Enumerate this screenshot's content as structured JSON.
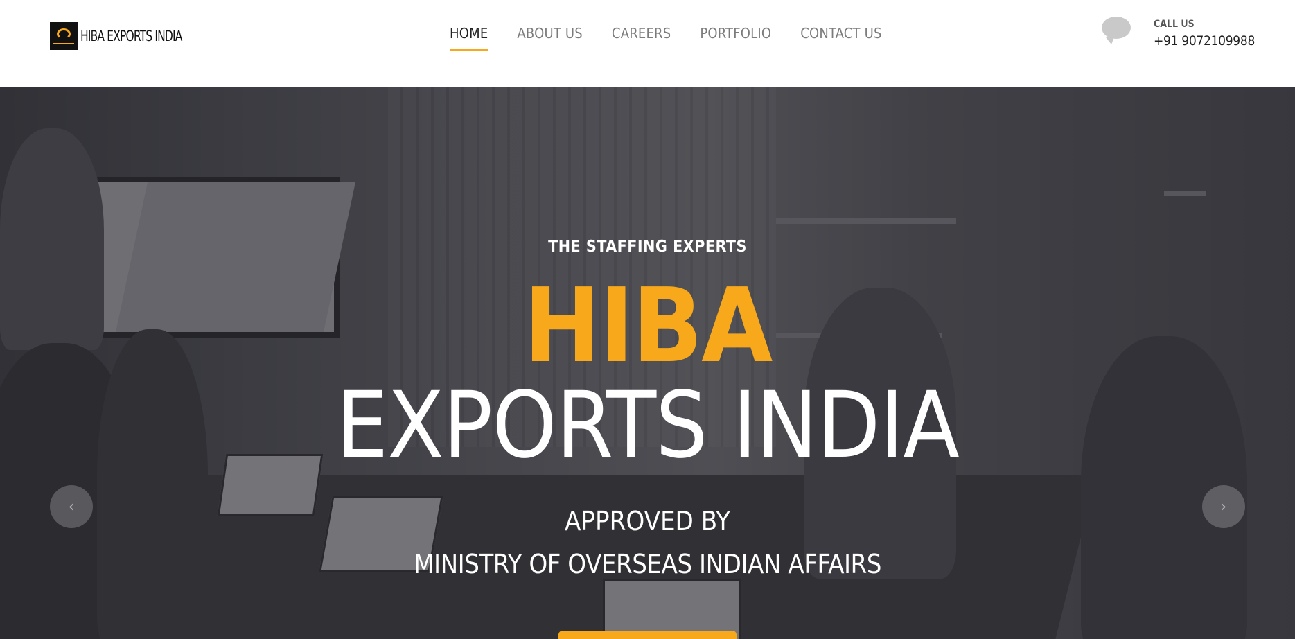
{
  "header": {
    "logo_text": "HIBA EXPORTS INDIA",
    "nav": [
      {
        "label": "HOME",
        "active": true
      },
      {
        "label": "ABOUT US",
        "active": false
      },
      {
        "label": "CAREERS",
        "active": false
      },
      {
        "label": "PORTFOLIO",
        "active": false
      },
      {
        "label": "CONTACT US",
        "active": false
      }
    ],
    "contact": {
      "label": "CALL US",
      "phone": "+91 9072109988",
      "icon": "chat-bubbles-icon"
    }
  },
  "hero": {
    "tagline": "THE STAFFING EXPERTS",
    "title_highlight": "HIBA",
    "title_rest": "EXPORTS INDIA",
    "approved_line": "APPROVED BY",
    "ministry_line": "MINISTRY OF OVERSEAS INDIAN AFFAIRS",
    "prev_icon": "chevron-left-icon",
    "next_icon": "chevron-right-icon",
    "prev_glyph": "‹",
    "next_glyph": "›"
  },
  "colors": {
    "accent": "#f7a81b",
    "nav_inactive": "#7b7b7b",
    "nav_active": "#222222"
  }
}
